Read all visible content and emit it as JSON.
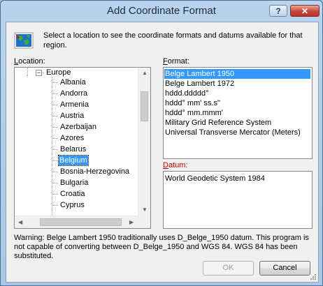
{
  "window": {
    "title": "Add Coordinate Format",
    "help_label": "?",
    "close_label": "✕"
  },
  "intro_text": "Select a location to see the coordinate formats and datums available for that region.",
  "location": {
    "label_pre": "",
    "label_accel": "L",
    "label_post": "ocation:",
    "parent": "Europe",
    "items": [
      "Albania",
      "Andorra",
      "Armenia",
      "Austria",
      "Azerbaijan",
      "Azores",
      "Belarus",
      "Belgium",
      "Bosnia-Herzegovina",
      "Bulgaria",
      "Croatia",
      "Cyprus"
    ],
    "selected": "Belgium"
  },
  "format": {
    "label_pre": "",
    "label_accel": "F",
    "label_post": "ormat:",
    "items": [
      "Belge Lambert 1950",
      "Belge Lambert 1972",
      "hddd.ddddd°",
      "hddd° mm' ss.s\"",
      "hddd° mm.mmm'",
      "Military Grid Reference System",
      "Universal Transverse Mercator (Meters)"
    ],
    "selected": "Belge Lambert 1950"
  },
  "datum": {
    "label_pre": "",
    "label_accel": "D",
    "label_post": "atum:",
    "value": "World Geodetic System 1984",
    "label_color": "#c00000"
  },
  "warning_text": "Warning: Belge Lambert 1950 traditionally uses D_Belge_1950 datum.  This program is not capable of converting between D_Belge_1950 and WGS 84.  WGS 84 has been substituted.",
  "buttons": {
    "ok": "OK",
    "cancel": "Cancel"
  },
  "icons": {
    "globe": "globe-icon",
    "close": "close-icon",
    "help": "help-icon"
  }
}
